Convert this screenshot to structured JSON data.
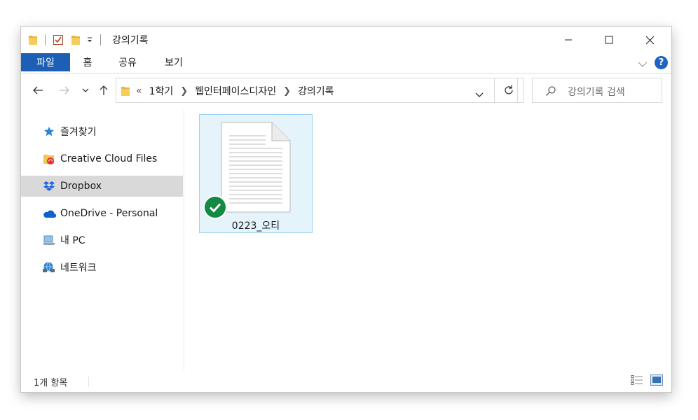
{
  "window": {
    "title": "강의기록"
  },
  "ribbon": {
    "tabs": [
      "파일",
      "홈",
      "공유",
      "보기"
    ],
    "help": "?"
  },
  "address": {
    "overflow": "«",
    "crumbs": [
      "1학기",
      "웹인터페이스디자인",
      "강의기록"
    ]
  },
  "search": {
    "placeholder": "강의기록 검색"
  },
  "sidebar": {
    "items": [
      {
        "label": "즐겨찾기",
        "icon": "star-icon"
      },
      {
        "label": "Creative Cloud Files",
        "icon": "creative-cloud-folder-icon"
      },
      {
        "label": "Dropbox",
        "icon": "dropbox-icon",
        "selected": true
      },
      {
        "label": "OneDrive - Personal",
        "icon": "onedrive-cloud-icon"
      },
      {
        "label": "내 PC",
        "icon": "computer-icon"
      },
      {
        "label": "네트워크",
        "icon": "network-icon"
      }
    ]
  },
  "files": [
    {
      "name": "0223_오티",
      "sync_status": "synced"
    }
  ],
  "status": {
    "count": "1개 항목"
  },
  "colors": {
    "accent": "#1d5fb5",
    "selection": "#e5f3fb",
    "selection_border": "#99d1f3",
    "sync_green": "#128a43"
  }
}
